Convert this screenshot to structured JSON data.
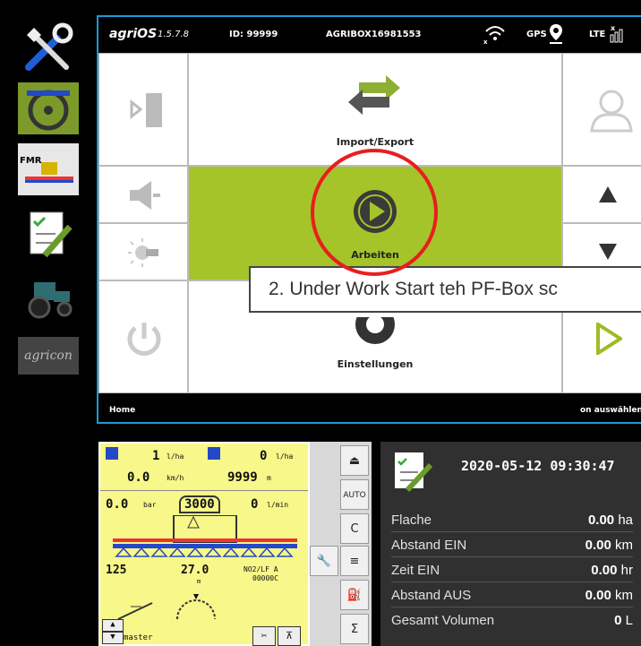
{
  "topbar": {
    "app": "agriOS",
    "version": "1.5.7.8",
    "id": "ID: 99999",
    "device": "AGRIBOX16981553",
    "gps": "GPS",
    "lte": "LTE"
  },
  "tiles": {
    "import_export": "Import/Export",
    "arbeiten": "Arbeiten",
    "einstellungen": "Einstellungen"
  },
  "status": {
    "left": "Home",
    "right": "on auswählen"
  },
  "tooltip": "2. Under Work Start teh PF-Box sc",
  "sidebar": {
    "brand_logo": "agricon",
    "fmr": "FMR"
  },
  "lcd": {
    "rate1": "1",
    "rate1_unit": "l/ha",
    "rate2": "0",
    "rate2_unit": "l/ha",
    "speed": "0.0",
    "speed_unit": "km/h",
    "dist": "9999",
    "dist_unit": "m",
    "pressure": "0.0",
    "pressure_unit": "bar",
    "tank": "3000",
    "flow": "0",
    "flow_unit": "l/min",
    "width": "125",
    "height": "27.0",
    "height_unit": "m",
    "nozzle": "NO2/LF A",
    "counter": "00000C",
    "master": "master"
  },
  "stats": {
    "date": "2020-05-12 09:30:47",
    "rows": [
      {
        "label": "Flache",
        "value": "0.00",
        "unit": "ha"
      },
      {
        "label": "Abstand EIN",
        "value": "0.00",
        "unit": "km"
      },
      {
        "label": "Zeit EIN",
        "value": "0.00",
        "unit": "hr"
      },
      {
        "label": "Abstand AUS",
        "value": "0.00",
        "unit": "km"
      },
      {
        "label": "Gesamt Volumen",
        "value": "0",
        "unit": "L"
      }
    ]
  },
  "colors": {
    "accent_green": "#a4c42a",
    "frame_blue": "#1a9bd6",
    "highlight_red": "#e81e1e"
  }
}
